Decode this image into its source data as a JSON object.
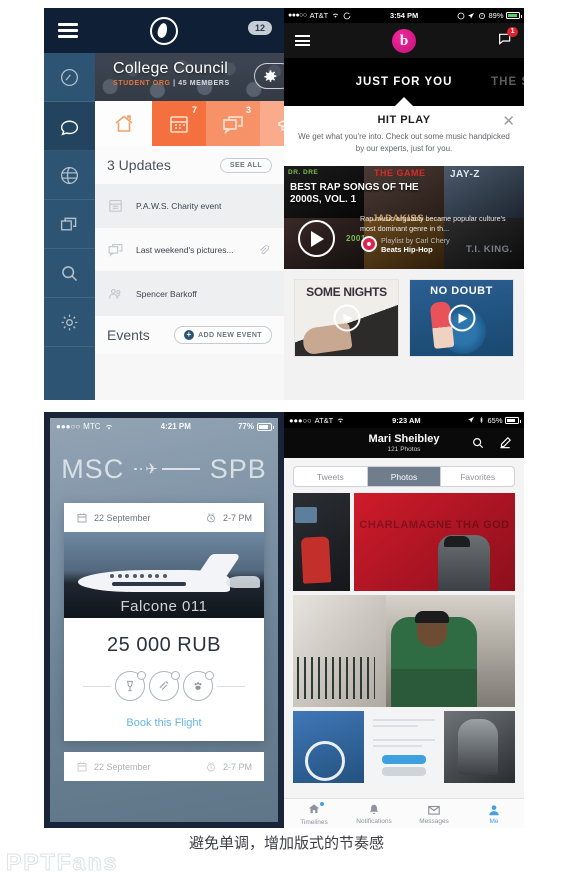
{
  "footer": {
    "caption": "避免单调，增加版式的节奏感",
    "watermark": "PPTFans"
  },
  "panel1": {
    "name": "college-council-app",
    "topbar": {
      "badge_count": "12",
      "menu_icon": "hamburger-icon",
      "logo_icon": "app-logo-icon"
    },
    "sidebar": {
      "items": [
        {
          "label": "Dashboard",
          "icon": "gauge-icon",
          "active": false
        },
        {
          "label": "Messages",
          "icon": "speech-bubble-icon",
          "active": true
        },
        {
          "label": "Globe",
          "icon": "globe-icon",
          "active": false
        },
        {
          "label": "Windows",
          "icon": "stacked-windows-icon",
          "active": false
        },
        {
          "label": "Search",
          "icon": "search-icon",
          "active": false
        },
        {
          "label": "Settings",
          "icon": "gear-icon",
          "active": false
        }
      ]
    },
    "hero": {
      "title": "College Council",
      "subtitle_org": "STUDENT ORG",
      "subtitle_sep": " | ",
      "subtitle_members": "45 MEMBERS",
      "settings_icon": "gear-icon"
    },
    "tabs": [
      {
        "icon": "home-icon",
        "badge": "",
        "state": "active"
      },
      {
        "icon": "calendar-icon",
        "badge": "7",
        "state": "inactive"
      },
      {
        "icon": "speech-bubbles-icon",
        "badge": "3",
        "state": "inactive"
      },
      {
        "icon": "megaphone-icon",
        "badge": "",
        "state": "inactive"
      }
    ],
    "updates_section": {
      "title": "3 Updates",
      "action_label": "SEE ALL",
      "rows": [
        {
          "icon": "calendar-icon",
          "text": "P.A.W.S. Charity event",
          "attachment": false
        },
        {
          "icon": "speech-bubbles-icon",
          "text": "Last weekend's pictures...",
          "attachment": true
        },
        {
          "icon": "people-icon",
          "text": "Spencer Barkoff",
          "attachment": false
        }
      ]
    },
    "events_section": {
      "title": "Events",
      "action_label": "ADD NEW EVENT",
      "action_icon": "plus-icon"
    },
    "colors": {
      "navy": "#0f1f36",
      "sidebar": "#2d5472",
      "accent_orange": "#f4713f"
    }
  },
  "panel2": {
    "name": "beats-music-app",
    "status_bar": {
      "signal_dots": "●●●○○",
      "carrier": "AT&T",
      "wifi_icon": "wifi-icon",
      "sync_icon": "sync-icon",
      "time": "3:54 PM",
      "location_icon": "location-arrow-icon",
      "alarm_icon": "alarm-icon",
      "battery_pct": "89%"
    },
    "navbar": {
      "menu_icon": "hamburger-icon",
      "logo": "b",
      "message_icon": "message-icon",
      "message_badge": "1"
    },
    "segments": [
      {
        "label": "JUST FOR YOU",
        "active": true
      },
      {
        "label": "THE S",
        "active": false
      }
    ],
    "hit_play": {
      "title": "HIT PLAY",
      "body": "We get what you're into. Check out some music handpicked by our experts, just for you.",
      "close_icon": "close-icon"
    },
    "feature": {
      "title": "BEST RAP SONGS OF THE 2000S, VOL. 1",
      "description": "Rap music arguably became popular culture's most dominant genre in th...",
      "byline": "Playlist by Carl Chery",
      "playlist": "Beats Hip-Hop",
      "play_icon": "play-icon",
      "art_labels": [
        "DR. DRE",
        "THE GAME",
        "JAY-Z",
        "JADAKISS",
        "T.I. KING.",
        "2001"
      ]
    },
    "cards": [
      {
        "label": "SOME NIGHTS",
        "play_icon": "play-icon"
      },
      {
        "label": "NO DOUBT",
        "play_icon": "play-icon"
      }
    ]
  },
  "panel3": {
    "name": "flight-booking-app",
    "status_bar": {
      "signal_dots": "●●●○○",
      "carrier": "MTC",
      "wifi_icon": "wifi-icon",
      "time": "4:21 PM",
      "battery_pct": "77%"
    },
    "route": {
      "origin": "MSC",
      "destination": "SPB",
      "plane_icon": "airplane-icon"
    },
    "flight_card": {
      "date": "22 September",
      "date_icon": "calendar-icon",
      "time_range": "2-7 PM",
      "time_icon": "alarm-clock-icon",
      "plane_name": "Falcone 011",
      "price": "25 000 RUB",
      "amenities": [
        {
          "icon": "wine-glass-icon",
          "label": "Drinks"
        },
        {
          "icon": "wifi-signal-icon",
          "label": "Wi-Fi"
        },
        {
          "icon": "pet-paw-icon",
          "label": "Pets"
        }
      ],
      "cta_label": "Book this Flight"
    },
    "next_card": {
      "date": "22 September",
      "date_icon": "calendar-icon",
      "time_range": "2-7 PM",
      "time_icon": "alarm-clock-icon"
    },
    "colors": {
      "frame": "#1a2438",
      "cta": "#69b4e0"
    }
  },
  "panel4": {
    "name": "twitter-profile-app",
    "status_bar": {
      "signal_dots": "●●●○○",
      "carrier": "AT&T",
      "wifi_icon": "wifi-icon",
      "time": "9:23 AM",
      "location_icon": "location-arrow-icon",
      "bluetooth_icon": "bluetooth-icon",
      "battery_pct": "65%"
    },
    "navbar": {
      "name": "Mari Sheibley",
      "subtitle": "121 Photos",
      "search_icon": "search-icon",
      "compose_icon": "compose-icon"
    },
    "segments": [
      {
        "label": "Tweets",
        "active": false
      },
      {
        "label": "Photos",
        "active": true
      },
      {
        "label": "Favorites",
        "active": false
      }
    ],
    "photos": [
      {
        "caption": "",
        "alt": "office-desk-photo"
      },
      {
        "caption": "CHARLAMAGNE THA GOD",
        "alt": "red-wall-portrait-photo"
      },
      {
        "caption": "",
        "alt": "street-portrait-photo"
      },
      {
        "caption": "",
        "alt": "blue-shirt-logo-photo"
      },
      {
        "caption": "",
        "alt": "app-screenshot-photo"
      },
      {
        "caption": "",
        "alt": "statue-photo"
      }
    ],
    "tabbar": [
      {
        "label": "Timelines",
        "icon": "home-icon",
        "active": false,
        "badge": true
      },
      {
        "label": "Notifications",
        "icon": "bell-icon",
        "active": false,
        "badge": false
      },
      {
        "label": "Messages",
        "icon": "envelope-icon",
        "active": false,
        "badge": false
      },
      {
        "label": "Me",
        "icon": "person-icon",
        "active": true,
        "badge": false
      }
    ],
    "colors": {
      "accent": "#4a9fe0",
      "navbar": "#0a0a0a"
    }
  }
}
